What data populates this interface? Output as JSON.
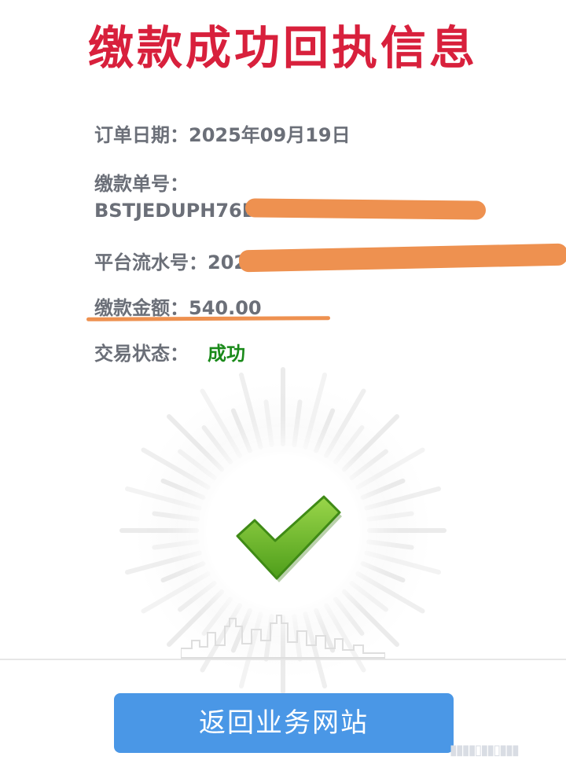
{
  "title": "缴款成功回执信息",
  "fields": {
    "order_date_label": "订单日期：",
    "order_date_value": "2025年09月19日",
    "payment_no_label": "缴款单号：",
    "payment_no_value": "BSTJEDUPH76D",
    "platform_serial_label": "平台流水号：",
    "platform_serial_value": "202",
    "amount_label": "缴款金额：",
    "amount_value": "540.00",
    "status_label": "交易状态：",
    "status_value": "成功"
  },
  "icons": [
    "check-icon",
    "skyline-icon"
  ],
  "button": {
    "label": "返回业务网站"
  },
  "colors": {
    "title": "#d8203c",
    "status_success": "#1a8a1a",
    "redaction": "#ee9150",
    "button": "#4a97e6",
    "check_green": "#6fbf2a"
  }
}
